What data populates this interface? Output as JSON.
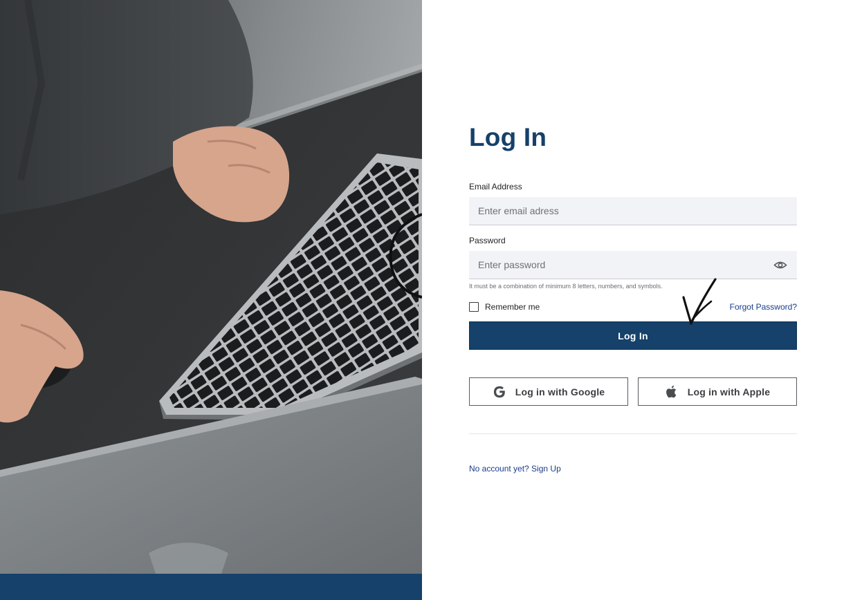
{
  "login": {
    "title": "Log In",
    "email": {
      "label": "Email Address",
      "placeholder": "Enter email adress",
      "value": ""
    },
    "password": {
      "label": "Password",
      "placeholder": "Enter password",
      "value": "",
      "toggle_icon": "eye-icon",
      "hint": "It must be a combination of minimum 8 letters, numbers, and symbols."
    },
    "remember_me": {
      "label": "Remember me",
      "checked": false
    },
    "forgot_password": "Forgot Password?",
    "submit_label": "Log In",
    "google_button": {
      "label": "Log in with Google",
      "icon": "google-icon"
    },
    "apple_button": {
      "label": "Log in with Apple",
      "icon": "apple-icon"
    },
    "signup_link": "No account yet? Sign Up"
  },
  "colors": {
    "brand": "#15416a",
    "link": "#1a3c8c",
    "input_bg": "#f2f3f6",
    "annotation": "#111111"
  }
}
